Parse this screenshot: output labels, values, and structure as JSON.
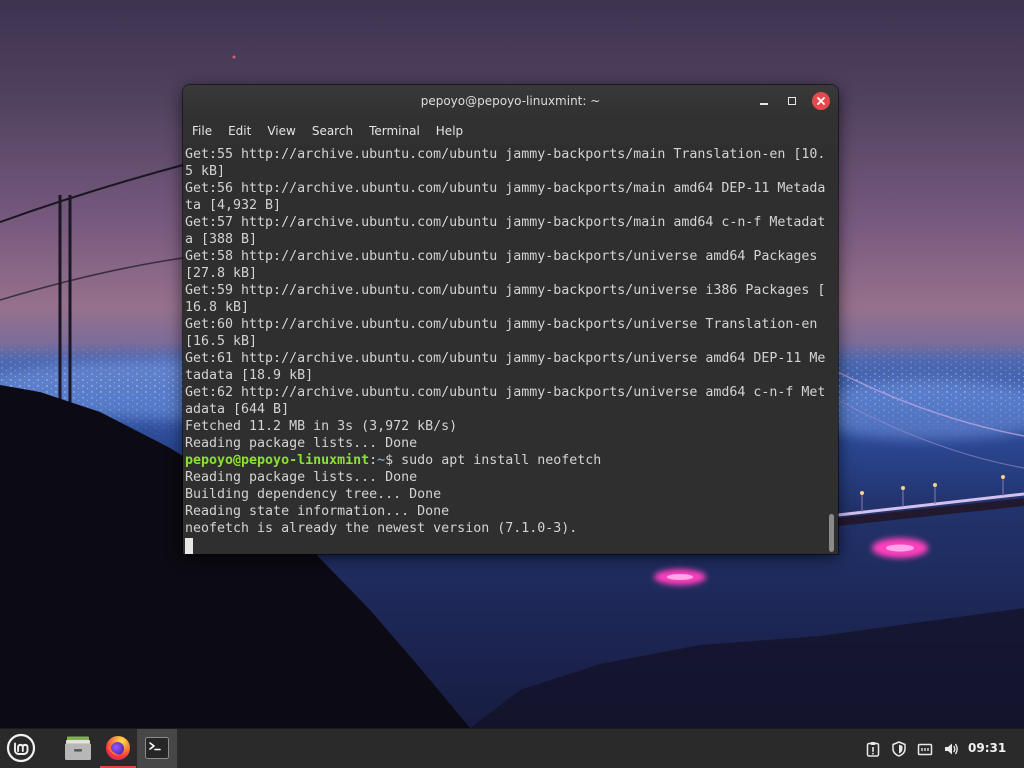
{
  "window": {
    "title": "pepoyo@pepoyo-linuxmint: ~",
    "controls": [
      "minimize-icon",
      "maximize-icon",
      "close-icon"
    ]
  },
  "menubar": {
    "items": [
      "File",
      "Edit",
      "View",
      "Search",
      "Terminal",
      "Help"
    ]
  },
  "terminal": {
    "output": [
      "Get:55 http://archive.ubuntu.com/ubuntu jammy-backports/main Translation-en [10.",
      "5 kB]",
      "Get:56 http://archive.ubuntu.com/ubuntu jammy-backports/main amd64 DEP-11 Metada",
      "ta [4,932 B]",
      "Get:57 http://archive.ubuntu.com/ubuntu jammy-backports/main amd64 c-n-f Metadat",
      "a [388 B]",
      "Get:58 http://archive.ubuntu.com/ubuntu jammy-backports/universe amd64 Packages",
      "[27.8 kB]",
      "Get:59 http://archive.ubuntu.com/ubuntu jammy-backports/universe i386 Packages [",
      "16.8 kB]",
      "Get:60 http://archive.ubuntu.com/ubuntu jammy-backports/universe Translation-en",
      "[16.5 kB]",
      "Get:61 http://archive.ubuntu.com/ubuntu jammy-backports/universe amd64 DEP-11 Me",
      "tadata [18.9 kB]",
      "Get:62 http://archive.ubuntu.com/ubuntu jammy-backports/universe amd64 c-n-f Met",
      "adata [644 B]",
      "Fetched 11.2 MB in 3s (3,972 kB/s)",
      "Reading package lists... Done"
    ],
    "prompt": {
      "user_host": "pepoyo@pepoyo-linuxmint",
      "separator": ":",
      "path": "~",
      "command": "$ sudo apt install neofetch"
    },
    "result": [
      "Reading package lists... Done",
      "Building dependency tree... Done",
      "Reading state information... Done",
      "neofetch is already the newest version (7.1.0-3)."
    ],
    "scrollbar": {
      "position": 1.0,
      "thumb_fraction": 0.094
    }
  },
  "taskbar": {
    "menu_icon": "linux-mint-menu-icon",
    "launchers": [
      {
        "icon": "file-manager-icon",
        "running": false,
        "focused": false
      },
      {
        "icon": "firefox-icon",
        "running": true,
        "focused": false
      },
      {
        "icon": "terminal-icon",
        "running": true,
        "focused": true
      }
    ],
    "tray_icons": [
      "system-reports-icon",
      "update-manager-icon",
      "network-icon",
      "volume-icon"
    ],
    "clock": "09:31"
  },
  "colors": {
    "terminal-bg": "#2f2f2f",
    "terminal-fg": "#d3d3d3",
    "prompt-user": "#8ae234",
    "prompt-path": "#729fcf",
    "close-button": "#e5484d",
    "running-indicator": "#e0453e",
    "taskbar-bg": "#2a2a2a"
  }
}
